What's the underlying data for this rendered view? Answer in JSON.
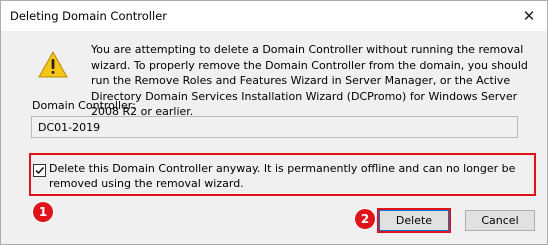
{
  "dialog": {
    "title": "Deleting Domain Controller",
    "close_glyph": "✕",
    "icon": "warning-icon",
    "message": "You are attempting to delete a Domain Controller without running the removal wizard. To properly remove the Domain Controller from the domain, you should run the Remove Roles and Features Wizard in Server Manager, or the Active Directory Domain Services Installation Wizard (DCPromo) for Windows Server 2008 R2 or earlier.",
    "dc_label": "Domain Controller:",
    "dc_value": "DC01-2019",
    "checkbox_label": "Delete this Domain Controller anyway. It is permanently offline and can no longer be removed using the removal wizard.",
    "checkbox_checked": true,
    "delete_label": "Delete",
    "cancel_label": "Cancel"
  },
  "annotations": {
    "badge_1": "1",
    "badge_2": "2",
    "highlight_color": "#e0131a"
  }
}
